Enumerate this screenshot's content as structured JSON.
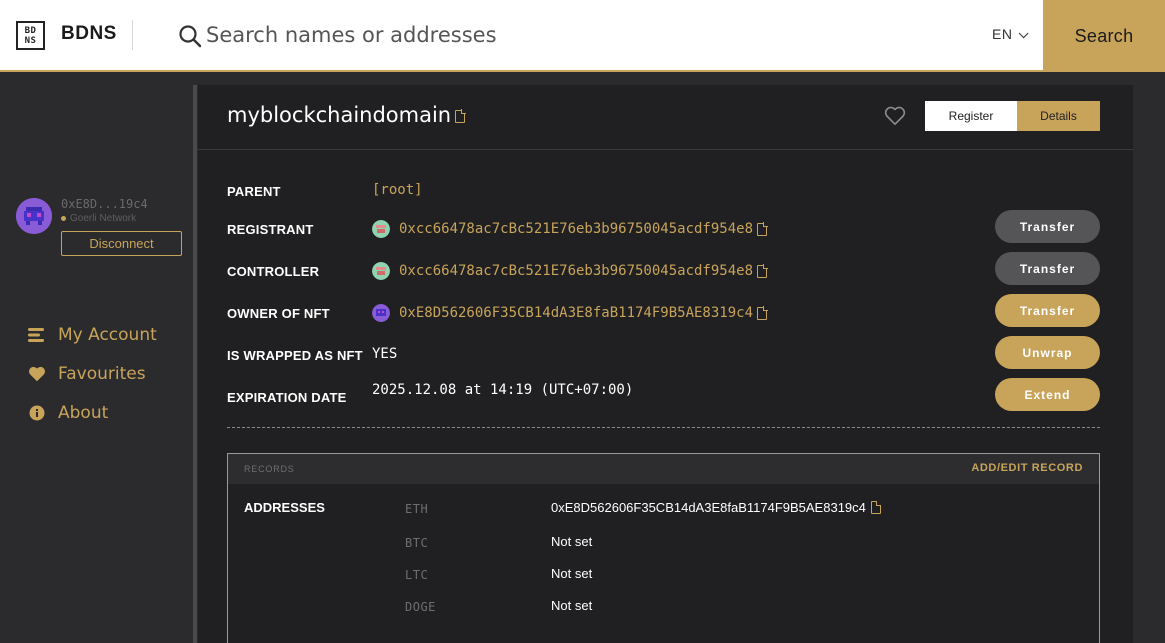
{
  "header": {
    "logo_text_top": "BD",
    "logo_text_bottom": "NS",
    "brand": "BDNS",
    "search_placeholder": "Search names or addresses",
    "language": "EN",
    "search_button": "Search"
  },
  "sidebar": {
    "account": {
      "address": "0xE8D...19c4",
      "network": "Goerli Network",
      "disconnect_label": "Disconnect"
    },
    "nav": [
      {
        "label": "My Account",
        "icon": "account-icon"
      },
      {
        "label": "Favourites",
        "icon": "heart-icon"
      },
      {
        "label": "About",
        "icon": "info-icon"
      }
    ]
  },
  "domain": {
    "name": "myblockchaindomain",
    "tabs": {
      "register": "Register",
      "details": "Details"
    },
    "fields": {
      "parent": {
        "label": "PARENT",
        "value": "[root]"
      },
      "registrant": {
        "label": "REGISTRANT",
        "value": "0xcc66478ac7cBc521E76eb3b96750045acdf954e8",
        "action": "Transfer"
      },
      "controller": {
        "label": "CONTROLLER",
        "value": "0xcc66478ac7cBc521E76eb3b96750045acdf954e8",
        "action": "Transfer"
      },
      "owner_nft": {
        "label": "OWNER OF NFT",
        "value": "0xE8D562606F35CB14dA3E8faB1174F9B5AE8319c4",
        "action": "Transfer"
      },
      "wrapped": {
        "label": "IS WRAPPED AS NFT",
        "value": "YES",
        "action": "Unwrap"
      },
      "expiration": {
        "label": "EXPIRATION DATE",
        "value": "2025.12.08 at 14:19 (UTC+07:00)",
        "action": "Extend"
      }
    }
  },
  "records": {
    "title": "RECORDS",
    "add_edit": "ADD/EDIT RECORD",
    "addresses_label": "ADDRESSES",
    "coins": [
      {
        "coin": "ETH",
        "value": "0xE8D562606F35CB14dA3E8faB1174F9B5AE8319c4"
      },
      {
        "coin": "BTC",
        "value": "Not set"
      },
      {
        "coin": "LTC",
        "value": "Not set"
      },
      {
        "coin": "DOGE",
        "value": "Not set"
      }
    ]
  },
  "colors": {
    "accent": "#c8a45a",
    "panel": "#202022",
    "background": "#2b2b2d"
  }
}
